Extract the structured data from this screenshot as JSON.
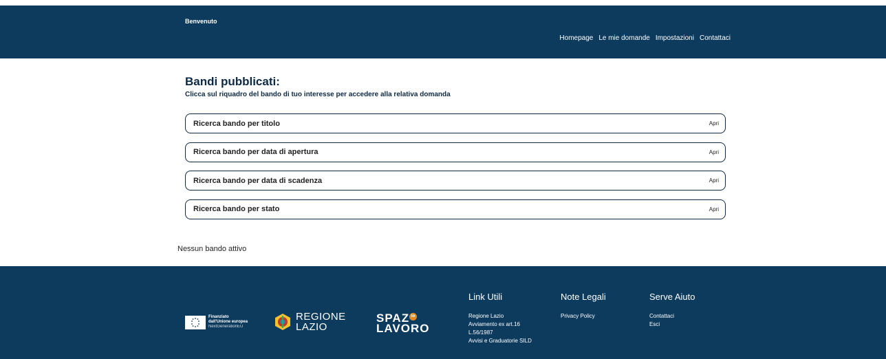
{
  "header": {
    "welcome": "Benvenuto",
    "nav": [
      "Homepage",
      "Le mie domande",
      "Impostazioni",
      "Contattaci"
    ]
  },
  "main": {
    "title": "Bandi pubblicati:",
    "subtitle": "Clicca sul riquadro del bando di tuo interesse per accedere alla relativa domanda",
    "searches": [
      {
        "label": "Ricerca bando per titolo",
        "action": "Apri"
      },
      {
        "label": "Ricerca bando per data di apertura",
        "action": "Apri"
      },
      {
        "label": "Ricerca bando per data di scadenza",
        "action": "Apri"
      },
      {
        "label": "Ricerca bando per stato",
        "action": "Apri"
      }
    ],
    "empty_message": "Nessun bando attivo"
  },
  "footer": {
    "eu_logo": {
      "line1": "Finanziato",
      "line2": "dall'Unione europea",
      "line3": "NextGenerationEU"
    },
    "lazio_logo": {
      "line1": "REGIONE",
      "line2": "LAZIO"
    },
    "spazio_logo": {
      "line1": "SPAZ",
      "badge": "io",
      "line2": "LAVORO"
    },
    "columns": [
      {
        "title": "Link Utili",
        "links": [
          "Regione Lazio",
          "Avviamento ex art.16",
          "L.56/1987",
          "Avvisi e Graduatorie SILD"
        ]
      },
      {
        "title": "Note Legali",
        "links": [
          "Privacy Policy"
        ]
      },
      {
        "title": "Serve Aiuto",
        "links": [
          "Contattaci",
          "Esci"
        ]
      }
    ]
  },
  "colors": {
    "primary": "#0d3b5e",
    "accent": "#e98a21",
    "text": "#0d2a44"
  }
}
